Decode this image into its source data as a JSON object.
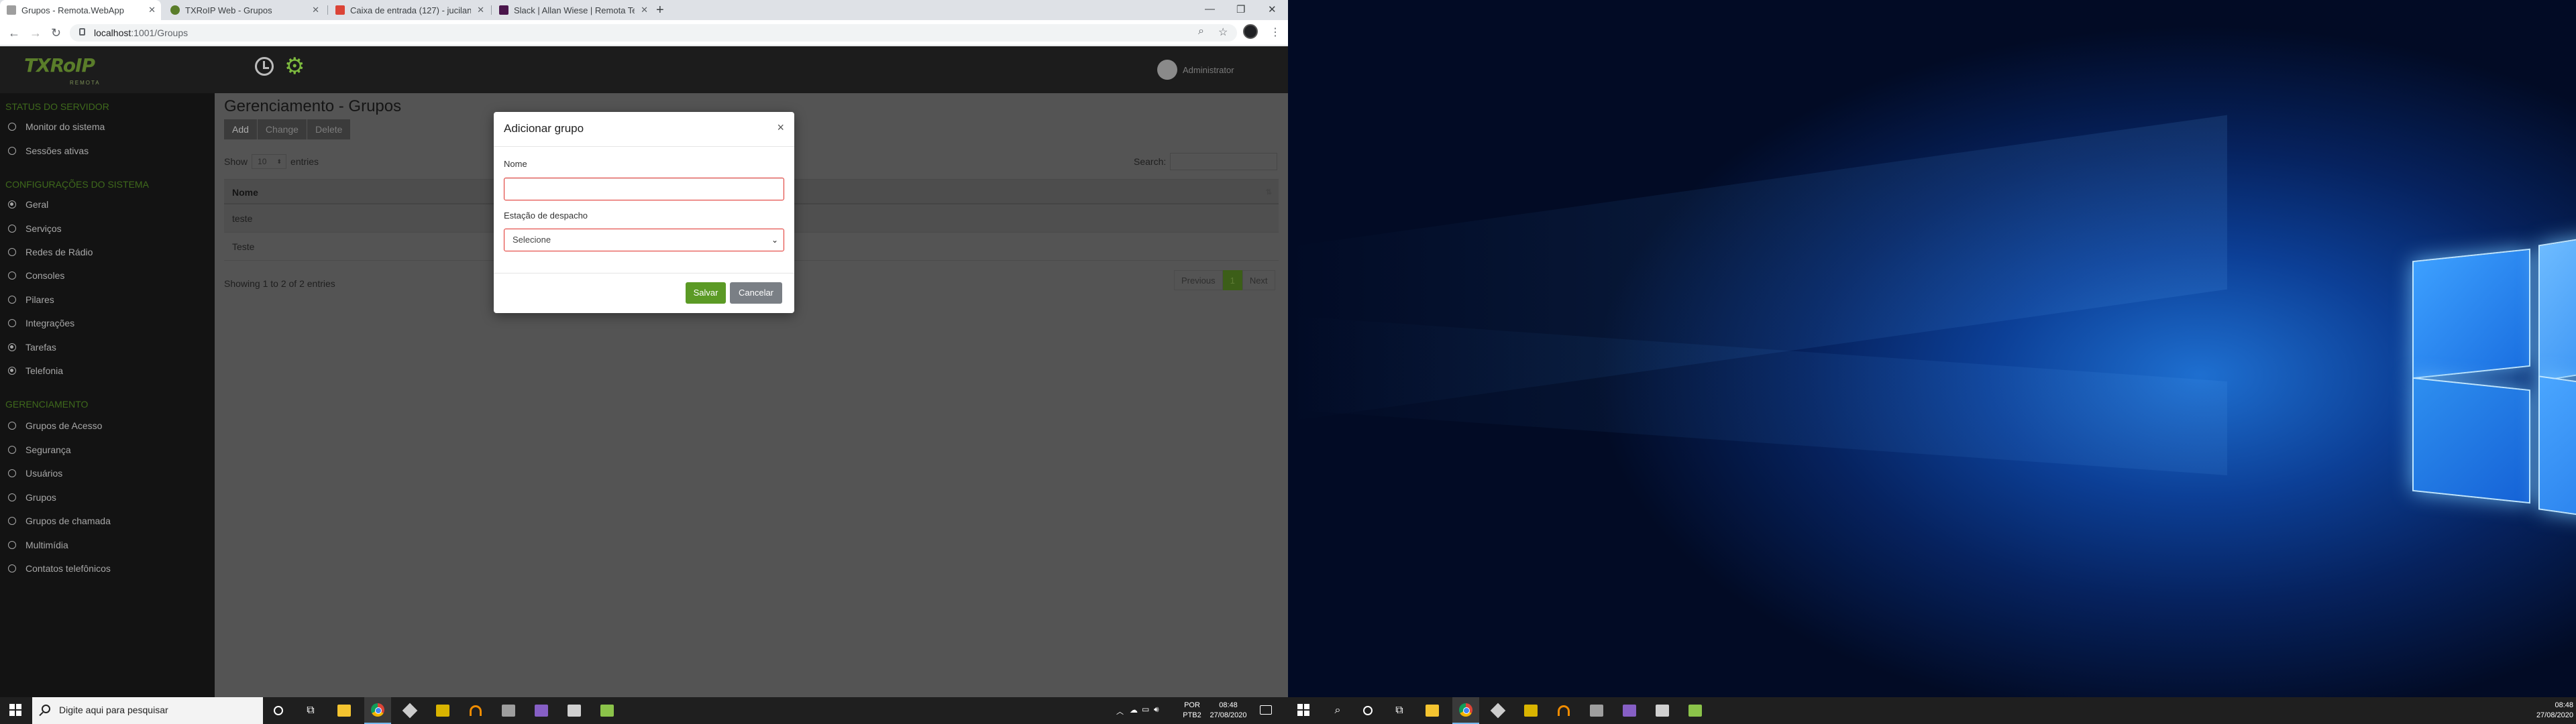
{
  "browser": {
    "tabs": [
      {
        "title": "Grupos - Remota.WebApp",
        "favicon_color": "#9e9e9e"
      },
      {
        "title": "TXRoIP Web - Grupos",
        "favicon_color": "#5a7d2a"
      },
      {
        "title": "Caixa de entrada (127) - jucilan@...",
        "favicon_color": "#db4437"
      },
      {
        "title": "Slack | Allan Wiese | Remota Tec...",
        "favicon_color": "#4a154b"
      }
    ],
    "url_host": "localhost",
    "url_path": ":1001/Groups"
  },
  "app": {
    "logo_text": "TXRoIP",
    "logo_sub": "REMOTA",
    "user": "Administrator",
    "sidebar": {
      "sections": [
        {
          "title": "STATUS DO SERVIDOR",
          "items": [
            {
              "label": "Monitor do sistema",
              "selected": false
            },
            {
              "label": "Sessões ativas",
              "selected": false
            }
          ]
        },
        {
          "title": "CONFIGURAÇÕES DO SISTEMA",
          "items": [
            {
              "label": "Geral",
              "selected": true
            },
            {
              "label": "Serviços",
              "selected": false
            },
            {
              "label": "Redes de Rádio",
              "selected": false
            },
            {
              "label": "Consoles",
              "selected": false
            },
            {
              "label": "Pilares",
              "selected": false
            },
            {
              "label": "Integrações",
              "selected": false
            },
            {
              "label": "Tarefas",
              "selected": true
            },
            {
              "label": "Telefonia",
              "selected": true
            }
          ]
        },
        {
          "title": "GERENCIAMENTO",
          "items": [
            {
              "label": "Grupos de Acesso",
              "selected": false
            },
            {
              "label": "Segurança",
              "selected": false
            },
            {
              "label": "Usuários",
              "selected": false
            },
            {
              "label": "Grupos",
              "selected": false
            },
            {
              "label": "Grupos de chamada",
              "selected": false
            },
            {
              "label": "Multimídia",
              "selected": false
            },
            {
              "label": "Contatos telefônicos",
              "selected": false
            }
          ]
        }
      ]
    },
    "content": {
      "title": "Gerenciamento - Grupos",
      "buttons": {
        "add": "Add",
        "change": "Change",
        "delete": "Delete"
      },
      "show_label": "Show",
      "entries_value": "10",
      "entries_label": "entries",
      "search_label": "Search:",
      "table": {
        "column": "Nome",
        "rows": [
          "teste",
          "Teste"
        ]
      },
      "showing": "Showing 1 to 2 of 2 entries",
      "pager": {
        "previous": "Previous",
        "current": "1",
        "next": "Next"
      }
    },
    "modal": {
      "title": "Adicionar grupo",
      "close": "×",
      "name_label": "Nome",
      "name_value": "",
      "dispatch_label": "Estação de despacho",
      "dispatch_value": "Selecione",
      "save": "Salvar",
      "cancel": "Cancelar"
    }
  },
  "taskbar_left": {
    "search_placeholder": "Digite aqui para pesquisar",
    "lang_top": "POR",
    "lang_bottom": "PTB2",
    "time": "08:48",
    "date": "27/08/2020"
  },
  "taskbar_right": {
    "time": "08:48",
    "date": "27/08/2020"
  }
}
